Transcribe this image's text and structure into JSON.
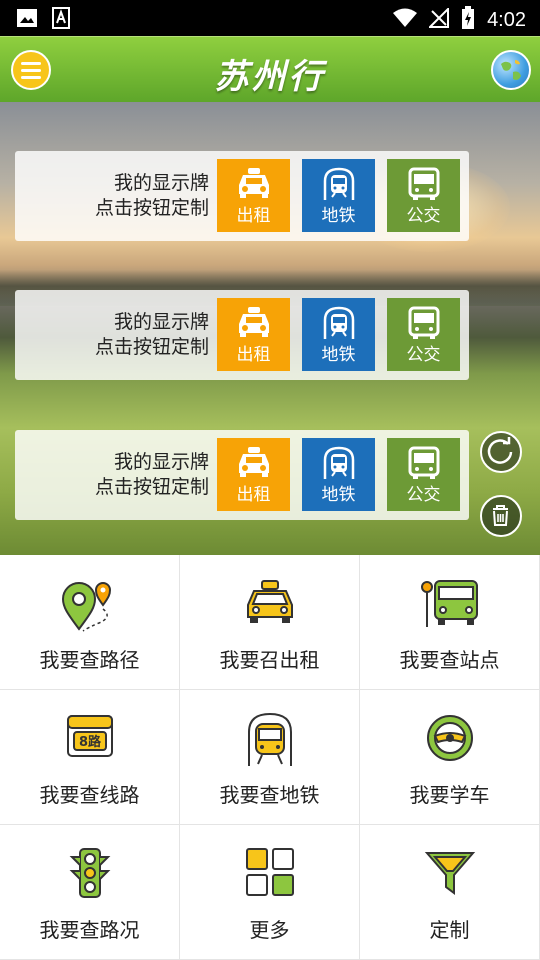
{
  "status_bar": {
    "time": "4:02"
  },
  "header": {
    "title": "苏州行"
  },
  "cards": [
    {
      "line1": "我的显示牌",
      "line2": "点击按钮定制",
      "taxi": "出租",
      "metro": "地铁",
      "bus": "公交"
    },
    {
      "line1": "我的显示牌",
      "line2": "点击按钮定制",
      "taxi": "出租",
      "metro": "地铁",
      "bus": "公交"
    },
    {
      "line1": "我的显示牌",
      "line2": "点击按钮定制",
      "taxi": "出租",
      "metro": "地铁",
      "bus": "公交"
    }
  ],
  "grid": [
    {
      "label": "我要查路径",
      "icon": "route-pin-icon"
    },
    {
      "label": "我要召出租",
      "icon": "taxi-icon"
    },
    {
      "label": "我要查站点",
      "icon": "bus-stop-icon"
    },
    {
      "label": "我要查线路",
      "icon": "bus-line-8-icon",
      "badge": "8路"
    },
    {
      "label": "我要查地铁",
      "icon": "metro-train-icon"
    },
    {
      "label": "我要学车",
      "icon": "steering-wheel-icon"
    },
    {
      "label": "我要查路况",
      "icon": "traffic-light-icon"
    },
    {
      "label": "更多",
      "icon": "more-grid-icon"
    },
    {
      "label": "定制",
      "icon": "filter-funnel-icon"
    }
  ],
  "colors": {
    "taxi": "#f7a306",
    "metro": "#1d6fba",
    "bus": "#6d9a36",
    "header": "#6fb52f",
    "accent_yellow": "#f7c51a"
  }
}
